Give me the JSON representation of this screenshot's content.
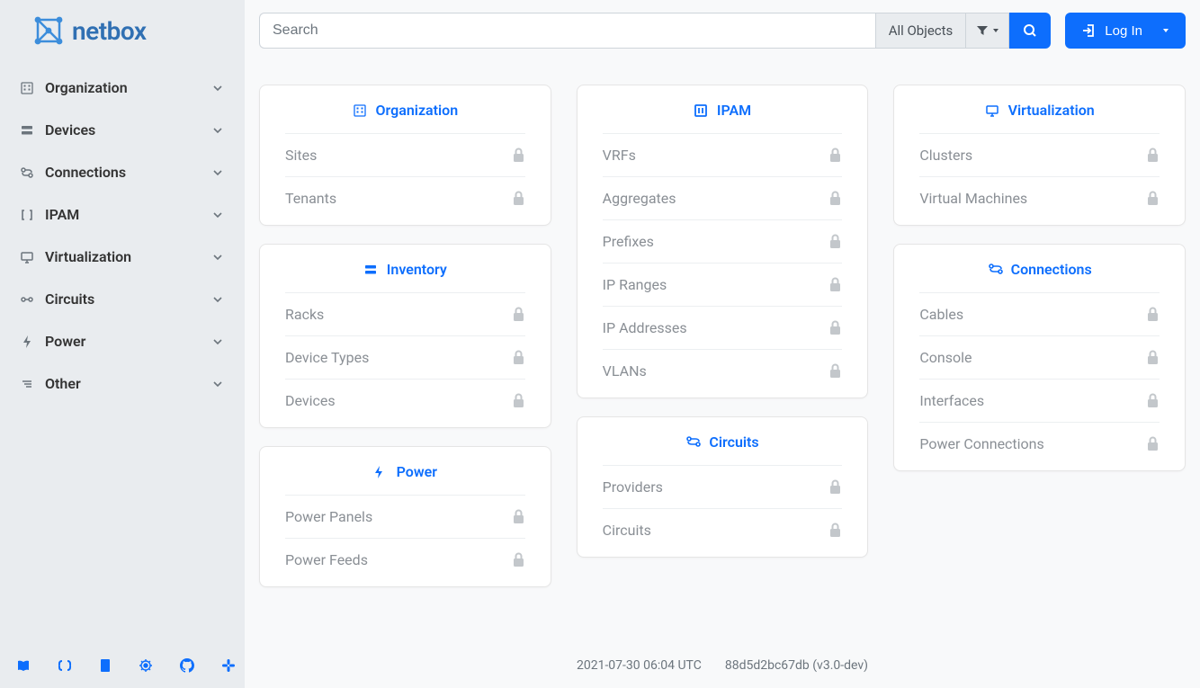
{
  "brand": {
    "name": "netbox"
  },
  "sidebar": {
    "items": [
      {
        "icon": "building",
        "label": "Organization"
      },
      {
        "icon": "server",
        "label": "Devices"
      },
      {
        "icon": "plug",
        "label": "Connections"
      },
      {
        "icon": "brackets",
        "label": "IPAM"
      },
      {
        "icon": "monitor",
        "label": "Virtualization"
      },
      {
        "icon": "circuit",
        "label": "Circuits"
      },
      {
        "icon": "flash",
        "label": "Power"
      },
      {
        "icon": "menu",
        "label": "Other"
      }
    ],
    "footer_icons": [
      "docs",
      "api",
      "changelog",
      "github-bug",
      "github",
      "slack"
    ]
  },
  "topbar": {
    "search_placeholder": "Search",
    "object_selector": "All Objects",
    "login_label": "Log In"
  },
  "dashboard": {
    "columns": [
      [
        {
          "title": "Organization",
          "icon": "building",
          "rows": [
            "Sites",
            "Tenants"
          ]
        },
        {
          "title": "Inventory",
          "icon": "server",
          "rows": [
            "Racks",
            "Device Types",
            "Devices"
          ]
        },
        {
          "title": "Power",
          "icon": "flash",
          "rows": [
            "Power Panels",
            "Power Feeds"
          ]
        }
      ],
      [
        {
          "title": "IPAM",
          "icon": "brackets",
          "rows": [
            "VRFs",
            "Aggregates",
            "Prefixes",
            "IP Ranges",
            "IP Addresses",
            "VLANs"
          ]
        },
        {
          "title": "Circuits",
          "icon": "circuit",
          "rows": [
            "Providers",
            "Circuits"
          ]
        }
      ],
      [
        {
          "title": "Virtualization",
          "icon": "monitor",
          "rows": [
            "Clusters",
            "Virtual Machines"
          ]
        },
        {
          "title": "Connections",
          "icon": "plug",
          "rows": [
            "Cables",
            "Console",
            "Interfaces",
            "Power Connections"
          ]
        }
      ]
    ]
  },
  "status": {
    "timestamp": "2021-07-30 06:04 UTC",
    "version": "88d5d2bc67db (v3.0-dev)"
  }
}
